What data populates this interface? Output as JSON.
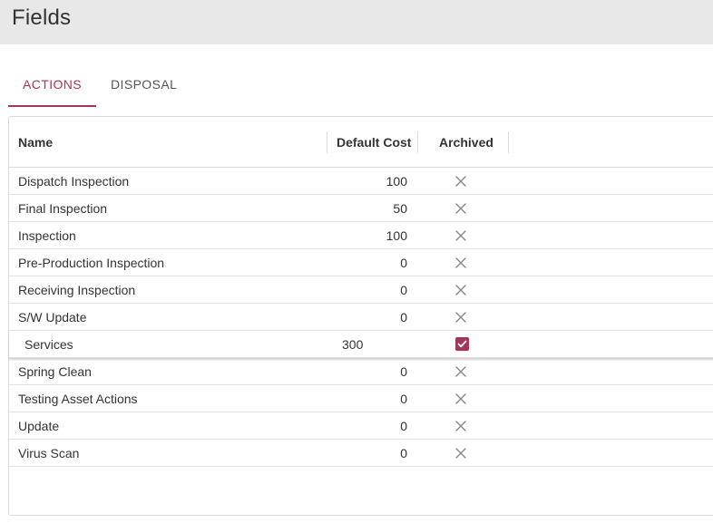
{
  "page": {
    "title": "Fields"
  },
  "tabs": [
    {
      "label": "ACTIONS",
      "active": true
    },
    {
      "label": "DISPOSAL",
      "active": false
    }
  ],
  "colors": {
    "accent": "#a3365b",
    "header_bg": "#e8e8e8"
  },
  "table": {
    "columns": {
      "name": "Name",
      "cost": "Default Cost",
      "archived": "Archived"
    },
    "rows": [
      {
        "name": "Dispatch Inspection",
        "cost": "100",
        "archived": false,
        "icon": "close-icon"
      },
      {
        "name": "Final Inspection",
        "cost": "50",
        "archived": false,
        "icon": "close-icon"
      },
      {
        "name": "Inspection",
        "cost": "100",
        "archived": false,
        "icon": "close-icon"
      },
      {
        "name": "Pre-Production Inspection",
        "cost": "0",
        "archived": false,
        "icon": "close-icon"
      },
      {
        "name": "Receiving Inspection",
        "cost": "0",
        "archived": false,
        "icon": "close-icon"
      },
      {
        "name": "S/W Update",
        "cost": "0",
        "archived": false,
        "icon": "close-icon"
      },
      {
        "name": "Services",
        "cost": "300",
        "archived": true,
        "icon": "checkbox-checked-icon",
        "editing": true
      },
      {
        "name": "Spring Clean",
        "cost": "0",
        "archived": false,
        "icon": "close-icon"
      },
      {
        "name": "Testing Asset Actions",
        "cost": "0",
        "archived": false,
        "icon": "close-icon"
      },
      {
        "name": "Update",
        "cost": "0",
        "archived": false,
        "icon": "close-icon"
      },
      {
        "name": "Virus Scan",
        "cost": "0",
        "archived": false,
        "icon": "close-icon"
      }
    ]
  }
}
